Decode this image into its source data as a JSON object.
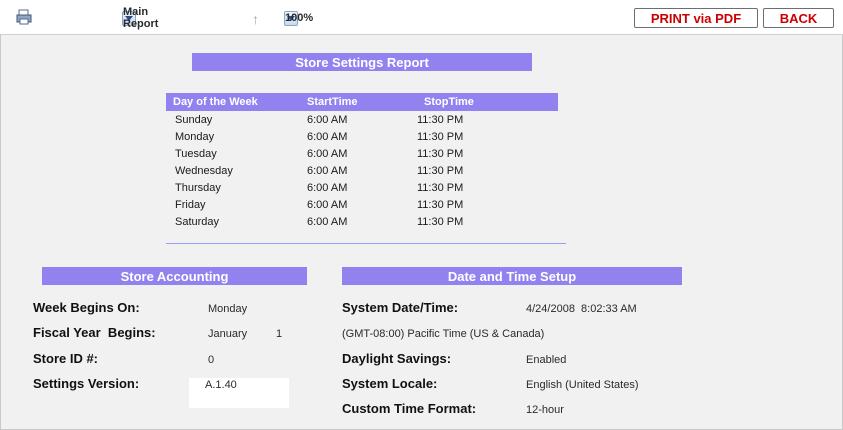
{
  "toolbar": {
    "report_select": "Main Report",
    "zoom_select": "100%",
    "print_button": "PRINT via PDF",
    "back_button": "BACK"
  },
  "report": {
    "title": "Store Settings Report",
    "schedule": {
      "columns": [
        "Day of the Week",
        "StartTime",
        "StopTime"
      ],
      "rows": [
        [
          "Sunday",
          "6:00 AM",
          "11:30 PM"
        ],
        [
          "Monday",
          "6:00 AM",
          "11:30 PM"
        ],
        [
          "Tuesday",
          "6:00 AM",
          "11:30 PM"
        ],
        [
          "Wednesday",
          "6:00 AM",
          "11:30 PM"
        ],
        [
          "Thursday",
          "6:00 AM",
          "11:30 PM"
        ],
        [
          "Friday",
          "6:00 AM",
          "11:30 PM"
        ],
        [
          "Saturday",
          "6:00 AM",
          "11:30 PM"
        ]
      ]
    },
    "store_accounting": {
      "title": "Store Accounting",
      "week_begins_label": "Week Begins On:",
      "week_begins_value": "Monday",
      "fiscal_year_label": "Fiscal Year  Begins:",
      "fiscal_month": "January",
      "fiscal_day": "1",
      "store_id_label": "Store ID #:",
      "store_id_value": "0",
      "settings_version_label": "Settings Version:",
      "settings_version_value": "A.1.40"
    },
    "date_time": {
      "title": "Date and Time Setup",
      "system_datetime_label": "System Date/Time:",
      "system_datetime_value": "4/24/2008  8:02:33 AM",
      "timezone": "(GMT-08:00) Pacific Time (US & Canada)",
      "daylight_label": "Daylight Savings:",
      "daylight_value": "Enabled",
      "locale_label": "System Locale:",
      "locale_value": "English (United States)",
      "time_format_label": "Custom Time Format:",
      "time_format_value": "12-hour"
    }
  },
  "colors": {
    "bar": "#9282f0",
    "accent": "#007a7a",
    "button_text": "#cc0000"
  }
}
